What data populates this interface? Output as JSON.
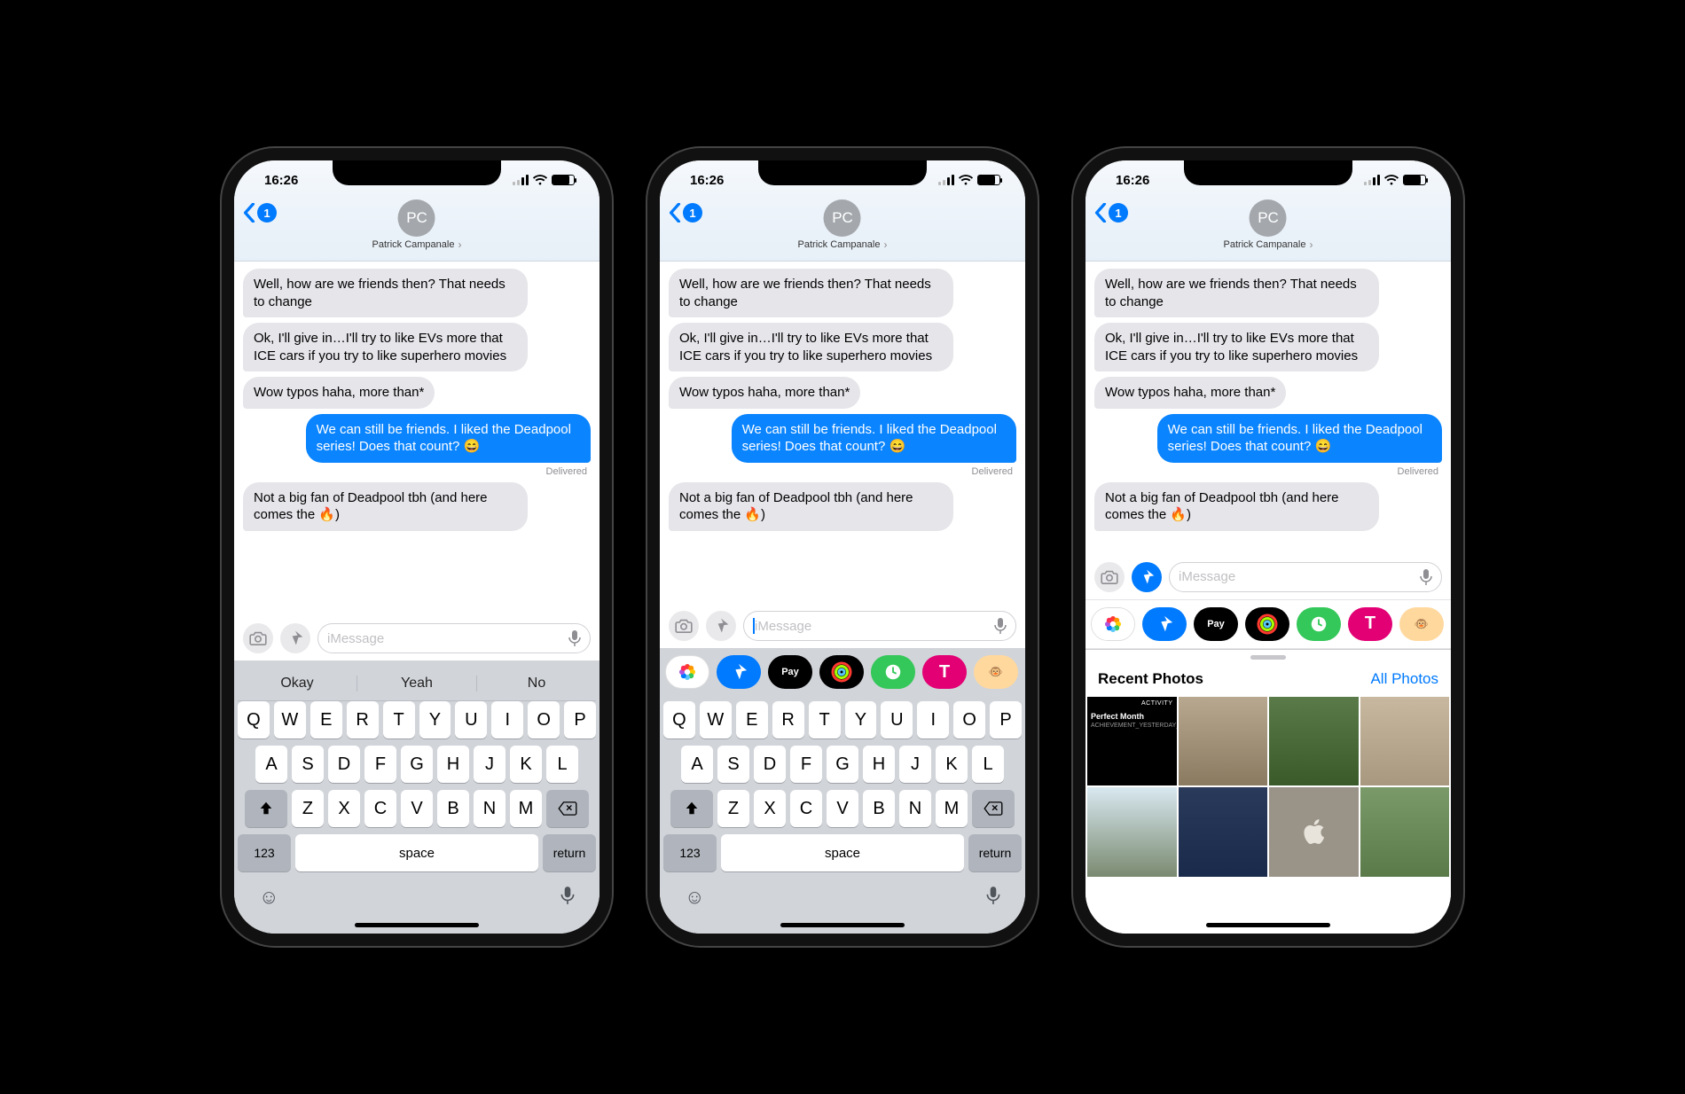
{
  "status": {
    "time": "16:26"
  },
  "header": {
    "back_badge": "1",
    "avatar_initials": "PC",
    "contact_name": "Patrick Campanale"
  },
  "messages": {
    "m1": "Well, how are we friends then? That needs to change",
    "m2": "Ok, I'll give in…I'll try to like EVs more that ICE cars if you try to like superhero movies",
    "m3": "Wow typos haha, more than*",
    "m4": "We can still be friends. I liked the Deadpool series! Does that count? 😄",
    "delivered": "Delivered",
    "m5": "Not a big fan of Deadpool tbh (and here comes the 🔥)"
  },
  "input": {
    "placeholder": "iMessage"
  },
  "predictions": {
    "p1": "Okay",
    "p2": "Yeah",
    "p3": "No"
  },
  "keyboard": {
    "r1": [
      "Q",
      "W",
      "E",
      "R",
      "T",
      "Y",
      "U",
      "I",
      "O",
      "P"
    ],
    "r2": [
      "A",
      "S",
      "D",
      "F",
      "G",
      "H",
      "J",
      "K",
      "L"
    ],
    "r3": [
      "Z",
      "X",
      "C",
      "V",
      "B",
      "N",
      "M"
    ],
    "numkey": "123",
    "space": "space",
    "return": "return"
  },
  "apps": {
    "photos": "Photos",
    "store": "Store",
    "pay": "Pay",
    "activity": "Activity",
    "clock": "Clock",
    "tmobile": "T",
    "animoji": "Animoji"
  },
  "photos_panel": {
    "title": "Recent Photos",
    "link": "All Photos",
    "activity_card": {
      "tag": "ACTIVITY",
      "title": "Perfect Month",
      "sub": "ACHIEVEMENT_YESTERDAY_DESC"
    }
  }
}
